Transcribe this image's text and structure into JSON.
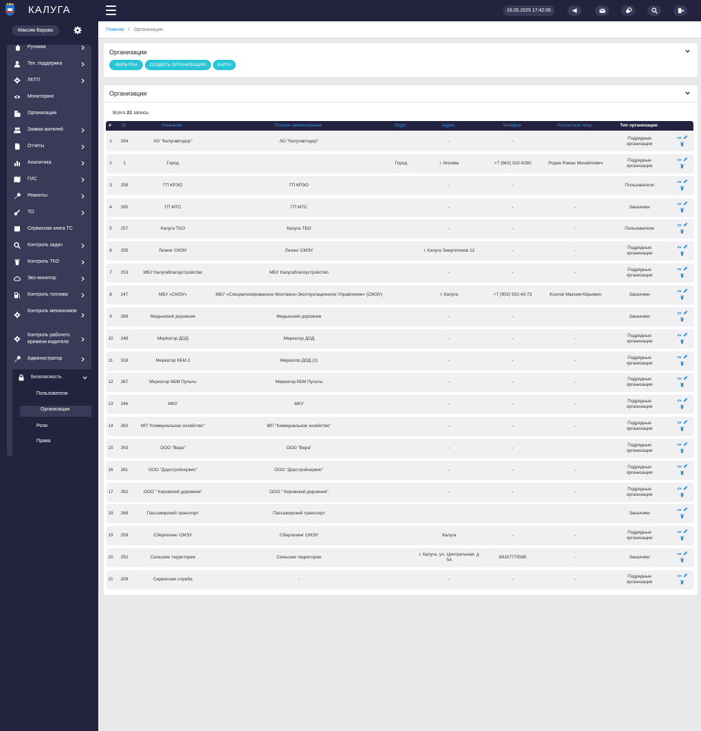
{
  "app": {
    "brand": "КАЛУГА",
    "datetime": "16.05.2025 17:42:06",
    "user_name": "Максим Варава"
  },
  "sidebar": {
    "items": [
      {
        "label": "Ручники",
        "icon": "hand-icon",
        "chevron": true
      },
      {
        "label": "Тех. поддержка",
        "icon": "user-icon",
        "chevron": true
      },
      {
        "label": "ЛКТП",
        "icon": "gear-icon",
        "chevron": true
      },
      {
        "label": "Мониторинг",
        "icon": "eye-icon",
        "chevron": false
      },
      {
        "label": "Организации",
        "icon": "building-icon",
        "chevron": false
      },
      {
        "label": "Заявки жителей",
        "icon": "users-icon",
        "chevron": true
      },
      {
        "label": "Отчёты",
        "icon": "document-icon",
        "chevron": true
      },
      {
        "label": "Аналитика",
        "icon": "chart-icon",
        "chevron": true
      },
      {
        "label": "ГИС",
        "icon": "map-icon",
        "chevron": true
      },
      {
        "label": "Ремонты",
        "icon": "wrench-icon",
        "chevron": true
      },
      {
        "label": "ТО",
        "icon": "tools-icon",
        "chevron": true
      },
      {
        "label": "Сервисная книга ТС",
        "icon": "book-icon",
        "chevron": false
      },
      {
        "label": "Контроль задач",
        "icon": "search-icon",
        "chevron": true
      },
      {
        "label": "Контроль ТКО",
        "icon": "trash-icon",
        "chevron": true
      },
      {
        "label": "Эко-монитор",
        "icon": "cloud-icon",
        "chevron": true
      },
      {
        "label": "Контроль топлива",
        "icon": "fuel-icon",
        "chevron": true
      },
      {
        "label": "Контроль механизмов",
        "icon": "cog-icon",
        "chevron": true
      },
      {
        "label": "Контроль рабочего времени водителя",
        "icon": "clock-gear-icon",
        "chevron": true
      },
      {
        "label": "Администратор",
        "icon": "admin-wrench-icon",
        "chevron": true
      }
    ],
    "security": {
      "label": "Безопасность",
      "icon": "lock-icon",
      "subitems": [
        "Пользователи",
        "Организации",
        "Роли",
        "Права"
      ]
    }
  },
  "breadcrumb": {
    "home": "Главная",
    "separator": "/",
    "current": "Организации"
  },
  "filters_card": {
    "title": "Организации",
    "buttons": [
      "ФИЛЬТРЫ",
      "СОЗДАТЬ ОРГАНИЗАЦИЮ",
      "КАРТА"
    ]
  },
  "table_card": {
    "title": "Организации",
    "total_prefix": "Всего",
    "total_count": "21",
    "total_suffix": "запись.",
    "columns": [
      "#",
      "ID",
      "Название",
      "Полное наименование",
      "Округ",
      "Адрес",
      "Телефон",
      "Контактное лицо",
      "Тип организации"
    ],
    "rows": [
      [
        "1",
        "264",
        "АО \"Калугавтодор\"",
        "АО \"Калугавтодор\"",
        "",
        "-",
        "-",
        "",
        "Подрядные организации"
      ],
      [
        "2",
        "1",
        "Город",
        "",
        "Город",
        "г. Москва",
        "+7 (962) 932-6280",
        "Родин Роман Михайлович",
        "Подрядные организации"
      ],
      [
        "3",
        "258",
        "ГП КРЭО",
        "ГП КРЭО",
        "",
        "-",
        "-",
        "",
        "Пользователи"
      ],
      [
        "4",
        "265",
        "ГП МТС",
        "ГП МТС",
        "",
        "-",
        "-",
        "-",
        "Заказчики"
      ],
      [
        "5",
        "257",
        "Калуга ТБО",
        "Калуга ТБО",
        "",
        "-",
        "-",
        "-",
        "Пользователи"
      ],
      [
        "6",
        "255",
        "Лизинг СМЭУ",
        "Лизинг СМЭУ",
        "",
        "г. Калуга Энергетиков 12",
        "-",
        "-",
        "Подрядные организации"
      ],
      [
        "7",
        "253",
        "МБУ Калугаблагоустройство",
        "МБУ Калугаблагоустройство",
        "",
        "-",
        "-",
        "-",
        "Подрядные организации"
      ],
      [
        "8",
        "247",
        "МБУ «СМЭУ»",
        "МБУ «Специализированное Монтажно-Эксплуатационное Управление» (СМЭУ)",
        "",
        "г. Калуга",
        "+7 (902) 932-43-73",
        "Козлов Максим Юрьевич",
        "Заказчики"
      ],
      [
        "9",
        "269",
        "Медынский дорожник",
        "Медынский дорожник",
        "",
        "-",
        "-",
        "",
        "Заказчики"
      ],
      [
        "10",
        "249",
        "Мерkатор ДОД",
        "Меркатор ДОД",
        "",
        "-",
        "-",
        "-",
        "Подрядные организации"
      ],
      [
        "11",
        "318",
        "Меркатор КБМ 2",
        "Меркатор ДОД (2)",
        "",
        "-",
        "-",
        "-",
        "Подрядные организации"
      ],
      [
        "12",
        "267",
        "Меркатор КБМ Пульты",
        "Меркатор КБМ Пульты",
        "",
        "-",
        "-",
        "-",
        "Подрядные организации"
      ],
      [
        "13",
        "246",
        "МКУ",
        "МКУ",
        "",
        "-",
        "-",
        "-",
        "Подрядные организации"
      ],
      [
        "14",
        "260",
        "МП \"Коммунальное хозяйство\"",
        "МП \"Коммунальное хозяйство\"",
        "",
        "-",
        "-",
        "-",
        "Подрядные организации"
      ],
      [
        "15",
        "263",
        "ООО \"Вера\"",
        "ООО \"Вера\"",
        "",
        "-",
        "-",
        "-",
        "Подрядные организации"
      ],
      [
        "16",
        "261",
        "ООО \"Дорстройсервис\"",
        "ООО \"Дорстройсервис\"",
        "",
        "-",
        "-",
        "-",
        "Подрядные организации"
      ],
      [
        "17",
        "262",
        "ООО \" Кировский дорожник\"",
        "ООО \" Кировский дорожник\"",
        "",
        "-",
        "-",
        "-",
        "Подрядные организации"
      ],
      [
        "18",
        "268",
        "Пассажирский транспорт",
        "Пассажирский транспорт",
        "",
        "",
        "",
        "",
        "Заказчики"
      ],
      [
        "19",
        "259",
        "Сберлизинг СМЭУ",
        "Сберлизинг СМЭУ",
        "",
        "Калуга",
        "-",
        "-",
        "Подрядные организации"
      ],
      [
        "20",
        "252",
        "Сельские территории",
        "Сельские территории",
        "",
        "г. Калуга, ул. Центральная, д 54",
        "89167775588",
        "-",
        "Заказчики"
      ],
      [
        "21",
        "209",
        "Сервисная служба",
        "-",
        "",
        "-",
        "-",
        "-",
        "Подрядные организации"
      ]
    ]
  },
  "colors": {
    "dark": "#23223f",
    "sidebar_panel": "#3a3958",
    "accent_cyan": "#26c6d8",
    "link_blue": "#3a8fe0"
  }
}
